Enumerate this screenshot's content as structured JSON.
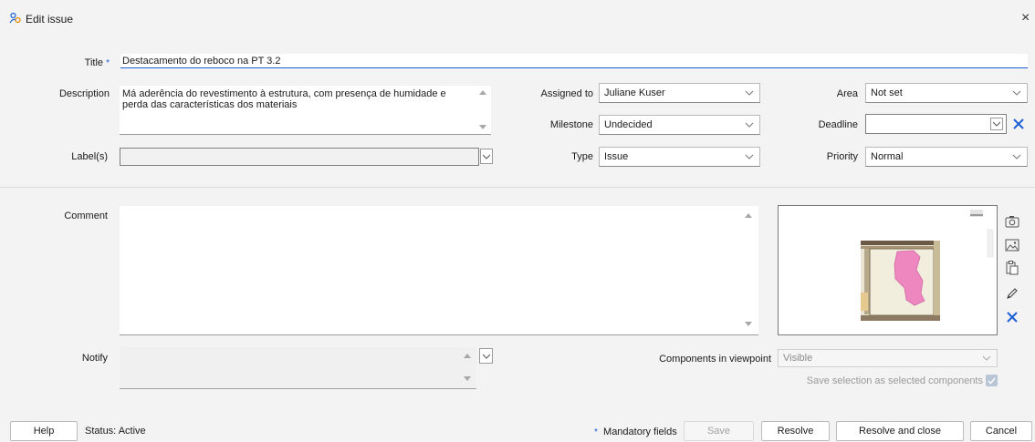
{
  "window": {
    "title": "Edit issue",
    "close_glyph": "×"
  },
  "form": {
    "title": {
      "label": "Title",
      "required_mark": "*",
      "value": "Destacamento do reboco na PT 3.2"
    },
    "description": {
      "label": "Description",
      "value": "Má aderência do revestimento à estrutura, com presença de humidade e perda das características dos materiais"
    },
    "labels": {
      "label": "Label(s)",
      "value": ""
    },
    "assigned_to": {
      "label": "Assigned to",
      "value": "Juliane Kuser"
    },
    "milestone": {
      "label": "Milestone",
      "value": "Undecided"
    },
    "type": {
      "label": "Type",
      "value": "Issue"
    },
    "area": {
      "label": "Area",
      "value": "Not set"
    },
    "deadline": {
      "label": "Deadline",
      "value": ""
    },
    "priority": {
      "label": "Priority",
      "value": "Normal"
    },
    "comment": {
      "label": "Comment",
      "value": ""
    },
    "notify": {
      "label": "Notify",
      "value": ""
    },
    "components_in_viewpoint": {
      "label": "Components in viewpoint",
      "value": "Visible"
    },
    "save_selection": {
      "label": "Save selection as selected components",
      "checked": true
    }
  },
  "footer": {
    "help": "Help",
    "status": "Status: Active",
    "mandatory_mark": "*",
    "mandatory_text": "Mandatory fields",
    "save": "Save",
    "resolve": "Resolve",
    "resolve_close": "Resolve and close",
    "cancel": "Cancel"
  },
  "icons": {
    "window": "people-icon",
    "camera": "camera-icon",
    "image": "image-icon",
    "paste": "paste-icon",
    "edit": "pencil-icon",
    "delete": "delete-x-icon"
  },
  "colors": {
    "accent": "#1e5fd6",
    "blob": "#ee86c0",
    "background": "#f3f3f3"
  }
}
